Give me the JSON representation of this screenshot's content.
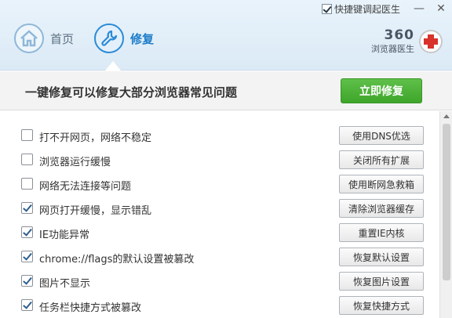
{
  "topbar": {
    "hotkey_label": "快捷键调起医生",
    "hotkey_checked": true,
    "minimize": "—",
    "close": "✕"
  },
  "nav": {
    "home_label": "首页",
    "repair_label": "修复",
    "home_icon": "house-icon",
    "repair_icon": "wrench-icon"
  },
  "brand": {
    "name": "360",
    "sub": "浏览器医生",
    "icon": "medical-cross-icon"
  },
  "banner": {
    "text": "一键修复可以修复大部分浏览器常见问题",
    "fix_button": "立即修复"
  },
  "issues": [
    {
      "label": "打不开网页，网络不稳定",
      "checked": false,
      "action": "使用DNS优选"
    },
    {
      "label": "浏览器运行缓慢",
      "checked": false,
      "action": "关闭所有扩展"
    },
    {
      "label": "网络无法连接等问题",
      "checked": false,
      "action": "使用断网急救箱"
    },
    {
      "label": "网页打开缓慢，显示错乱",
      "checked": true,
      "action": "清除浏览器缓存"
    },
    {
      "label": "IE功能异常",
      "checked": true,
      "action": "重置IE内核"
    },
    {
      "label": "chrome://flags的默认设置被篡改",
      "checked": true,
      "action": "恢复默认设置"
    },
    {
      "label": "图片不显示",
      "checked": true,
      "action": "恢复图片设置"
    },
    {
      "label": "任务栏快捷方式被篡改",
      "checked": true,
      "action": "恢复快捷方式"
    }
  ],
  "colors": {
    "accent": "#2b8bd6",
    "fix_green": "#3ea52a",
    "brand_red": "#d8322b"
  }
}
